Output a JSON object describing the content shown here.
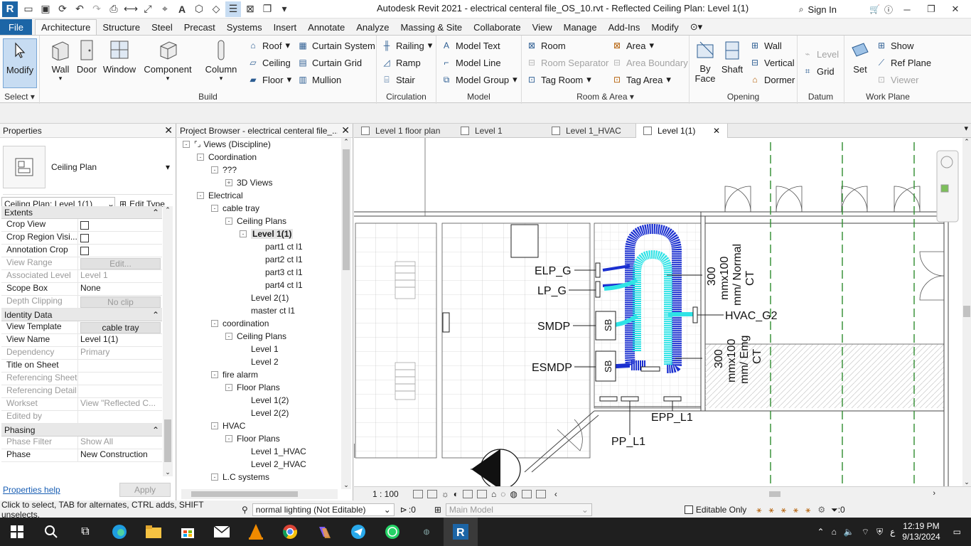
{
  "app": {
    "title": "Autodesk Revit 2021 - electrical centeral file_OS_10.rvt - Reflected Ceiling Plan: Level 1(1)",
    "sign_in": "Sign In",
    "logo_letter": "R",
    "brand_color": "#1c65a6"
  },
  "ribbon": {
    "tabs": [
      "File",
      "Architecture",
      "Structure",
      "Steel",
      "Precast",
      "Systems",
      "Insert",
      "Annotate",
      "Analyze",
      "Massing & Site",
      "Collaborate",
      "View",
      "Manage",
      "Add-Ins",
      "Modify"
    ],
    "active_tab": "Architecture",
    "select_label": "Select",
    "modify_label": "Modify",
    "build": {
      "label": "Build",
      "wall": "Wall",
      "door": "Door",
      "window": "Window",
      "component": "Component",
      "column": "Column",
      "roof": "Roof",
      "ceiling": "Ceiling",
      "floor": "Floor",
      "curtain_system": "Curtain System",
      "curtain_grid": "Curtain Grid",
      "mullion": "Mullion"
    },
    "circulation": {
      "label": "Circulation",
      "railing": "Railing",
      "ramp": "Ramp",
      "stair": "Stair"
    },
    "model": {
      "label": "Model",
      "text": "Model Text",
      "line": "Model Line",
      "group": "Model Group"
    },
    "room_area": {
      "label": "Room & Area",
      "room": "Room",
      "room_sep": "Room Separator",
      "tag_room": "Tag Room",
      "area": "Area",
      "area_boundary": "Area Boundary",
      "tag_area": "Tag Area"
    },
    "opening": {
      "label": "Opening",
      "by_face": "By Face",
      "shaft": "Shaft",
      "wall": "Wall",
      "vertical": "Vertical",
      "dormer": "Dormer"
    },
    "datum": {
      "label": "Datum",
      "level": "Level",
      "grid": "Grid"
    },
    "work_plane": {
      "label": "Work Plane",
      "set": "Set",
      "show": "Show",
      "ref_plane": "Ref Plane",
      "viewer": "Viewer"
    }
  },
  "properties": {
    "title": "Properties",
    "type_name": "Ceiling Plan",
    "instance_selector": "Ceiling Plan: Level 1(1)",
    "edit_type": "Edit Type",
    "sections": {
      "extents": "Extents",
      "identity": "Identity Data",
      "phasing": "Phasing"
    },
    "rows": {
      "crop_view": "Crop View",
      "crop_region": "Crop Region Visi...",
      "annotation_crop": "Annotation Crop",
      "view_range": "View Range",
      "view_range_btn": "Edit...",
      "assoc_level": "Associated Level",
      "assoc_level_val": "Level 1",
      "scope_box": "Scope Box",
      "scope_box_val": "None",
      "depth_clipping": "Depth Clipping",
      "depth_clipping_val": "No clip",
      "view_template": "View Template",
      "view_template_val": "cable tray",
      "view_name": "View Name",
      "view_name_val": "Level 1(1)",
      "dependency": "Dependency",
      "dependency_val": "Primary",
      "title_on_sheet": "Title on Sheet",
      "ref_sheet": "Referencing Sheet",
      "ref_detail": "Referencing Detail",
      "workset": "Workset",
      "workset_val": "View \"Reflected C...",
      "edited_by": "Edited by",
      "phase_filter": "Phase Filter",
      "phase_filter_val": "Show All",
      "phase": "Phase",
      "phase_val": "New Construction"
    },
    "help": "Properties help",
    "apply": "Apply"
  },
  "browser": {
    "title": "Project Browser - electrical centeral file_...",
    "nodes": [
      {
        "indent": 0,
        "toggle": "-",
        "label": "Views (Discipline)",
        "icon": true
      },
      {
        "indent": 1,
        "toggle": "-",
        "label": "Coordination"
      },
      {
        "indent": 2,
        "toggle": "-",
        "label": "???"
      },
      {
        "indent": 3,
        "toggle": "+",
        "label": "3D Views"
      },
      {
        "indent": 1,
        "toggle": "-",
        "label": "Electrical"
      },
      {
        "indent": 2,
        "toggle": "-",
        "label": "cable tray"
      },
      {
        "indent": 3,
        "toggle": "-",
        "label": "Ceiling Plans"
      },
      {
        "indent": 4,
        "toggle": "-",
        "label": "Level 1(1)",
        "selected": true
      },
      {
        "indent": 5,
        "toggle": "",
        "label": "part1 ct l1"
      },
      {
        "indent": 5,
        "toggle": "",
        "label": "part2 ct l1"
      },
      {
        "indent": 5,
        "toggle": "",
        "label": "part3 ct l1"
      },
      {
        "indent": 5,
        "toggle": "",
        "label": "part4 ct l1"
      },
      {
        "indent": 4,
        "toggle": "",
        "label": "Level 2(1)"
      },
      {
        "indent": 4,
        "toggle": "",
        "label": "master ct l1"
      },
      {
        "indent": 2,
        "toggle": "-",
        "label": "coordination"
      },
      {
        "indent": 3,
        "toggle": "-",
        "label": "Ceiling Plans"
      },
      {
        "indent": 4,
        "toggle": "",
        "label": "Level 1"
      },
      {
        "indent": 4,
        "toggle": "",
        "label": "Level 2"
      },
      {
        "indent": 2,
        "toggle": "-",
        "label": "fire alarm"
      },
      {
        "indent": 3,
        "toggle": "-",
        "label": "Floor Plans"
      },
      {
        "indent": 4,
        "toggle": "",
        "label": "Level 1(2)"
      },
      {
        "indent": 4,
        "toggle": "",
        "label": "Level 2(2)"
      },
      {
        "indent": 2,
        "toggle": "-",
        "label": "HVAC"
      },
      {
        "indent": 3,
        "toggle": "-",
        "label": "Floor Plans"
      },
      {
        "indent": 4,
        "toggle": "",
        "label": "Level 1_HVAC"
      },
      {
        "indent": 4,
        "toggle": "",
        "label": "Level 2_HVAC"
      },
      {
        "indent": 2,
        "toggle": "-",
        "label": "L.C systems"
      }
    ]
  },
  "view_tabs": [
    {
      "label": "Level 1 floor plan",
      "active": false
    },
    {
      "label": "Level 1",
      "active": false
    },
    {
      "label": "Level 1_HVAC",
      "active": false
    },
    {
      "label": "Level 1(1)",
      "active": true
    }
  ],
  "drawing": {
    "labels": {
      "elp": "ELP_G",
      "lp": "LP_G",
      "smdp": "SMDP",
      "esmdp": "ESMDP",
      "hvac": "HVAC_G2",
      "epp": "EPP_L1",
      "pp": "PP_L1",
      "sb": "SB",
      "normal_tray_1": "300",
      "normal_tray_2": "mmx100",
      "normal_tray_3": "mm/ Normal",
      "normal_tray_4": "CT",
      "emg_tray_1": "300",
      "emg_tray_2": "mmx100",
      "emg_tray_3": "mm/ Emg",
      "emg_tray_4": "CT"
    },
    "colors": {
      "normal_tray": "#2fe3e6",
      "emg_tray": "#1a2fd0",
      "grid": "#2e8b2e"
    }
  },
  "view_control": {
    "scale": "1 : 100"
  },
  "status": {
    "message": "Click to select, TAB for alternates, CTRL adds, SHIFT unselects.",
    "workset": "normal lighting (Not Editable)",
    "count": ":0",
    "design_option": "Main Model",
    "editable_only": "Editable Only",
    "filter_count": ":0"
  },
  "taskbar": {
    "time": "12:19 PM",
    "date": "9/13/2024",
    "lang": "ع"
  }
}
